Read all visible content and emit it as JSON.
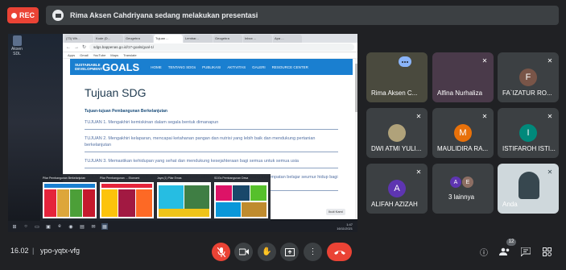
{
  "top": {
    "rec_label": "REC",
    "presenting_text": "Rima Aksen Cahdriyana sedang melakukan presentasi"
  },
  "desktop": {
    "icon_label": "Aksen SDL"
  },
  "browser": {
    "tabs": [
      "(73) Wh...",
      "Kode (D...",
      "Geogebra",
      "Tujuan ...",
      "Lembar...",
      "Geogebra",
      "Inbox ...",
      "Apa ..."
    ],
    "url": "sdgs.bappenas.go.id/17-goals/goal-1/",
    "bookmarks": [
      "Apps",
      "Gmail",
      "YouTube",
      "Maps",
      "Translate"
    ],
    "sdg_logo_small": "SUSTAINABLE DEVELOPMENT",
    "sdg_logo_big": "GOALS",
    "sdg_nav": [
      "HOME",
      "TENTANG SDGs",
      "PUBLIKASI",
      "AKTIVITAS",
      "GALERI",
      "RESOURCE CENTER"
    ],
    "page_title": "Tujuan SDG",
    "subtitle": "Tujuan-tujuan Pembangunan Berkelanjutan",
    "goals": [
      "TUJUAN 1. Mengakhiri kemiskinan dalam segala bentuk dimanapun",
      "TUJUAN 2. Mengakhiri kelaparan, mencapai ketahanan pangan dan nutrisi yang lebih baik dan mendukung pertanian berkelanjutan",
      "TUJUAN 3. Memastikan kehidupan yang sehat dan mendukung kesejahteraan bagi semua untuk semua usia",
      "TUJUAN 4. Memastikan pendidikan yang inklusif dan berkualitas setara, juga mendukung kesempatan belajar seumur hidup bagi semua"
    ],
    "badge": "Ikuti Kami"
  },
  "thumbnails": [
    {
      "title": "Pilar Pembangunan Berkelanjutan"
    },
    {
      "title": "Pilar Pembangunan ... Ekonomi"
    },
    {
      "title": "Jaya (1) Pilar Emas"
    },
    {
      "title": "SDGs Pembangunan Desa"
    }
  ],
  "taskbar": {
    "time": "1:47",
    "date": "16/11/2021"
  },
  "participants": [
    {
      "name": "Rima Aksen C...",
      "initial": "",
      "color": "#4a4a3e"
    },
    {
      "name": "Alfina Nurhaliza",
      "initial": "",
      "color": "#4a3a4a"
    },
    {
      "name": "FA`IZATUR RO...",
      "initial": "F",
      "color": "#795548"
    },
    {
      "name": "DWI ATMI YULI...",
      "initial": "",
      "color": "#3c4043"
    },
    {
      "name": "MAULIDIRA RA...",
      "initial": "M",
      "color": "#e8710a"
    },
    {
      "name": "ISTIFAROH ISTI...",
      "initial": "I",
      "color": "#00897b"
    },
    {
      "name": "ALIFAH AZIZAH",
      "initial": "A",
      "color": "#5e35b1"
    },
    {
      "name": "3 lainnya",
      "initial": "",
      "color": "#3c4043"
    },
    {
      "name": "Anda",
      "initial": "",
      "color": "#cfd8dc"
    }
  ],
  "others_initials": [
    "A",
    "E"
  ],
  "bottom": {
    "time": "16.02",
    "separator": "|",
    "meeting_code": "ypo-yqtx-vfg",
    "participant_count": "12"
  }
}
